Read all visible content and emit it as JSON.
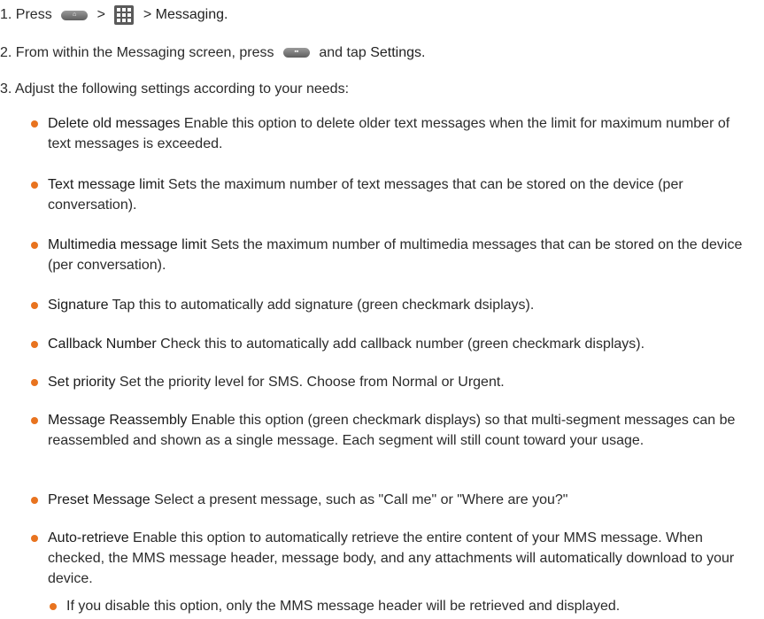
{
  "steps": [
    {
      "num": "1. Press",
      "sep1": ">",
      "sep2": ">",
      "target": "Messaging."
    },
    {
      "pre": "2. From within the Messaging screen, press",
      "mid": "and tap",
      "target": "Settings."
    },
    {
      "text": "3. Adjust the following settings according to your needs:"
    }
  ],
  "settings": [
    {
      "term": "Delete old messages",
      "desc": "Enable this option to delete older text messages when the limit for maximum number of text messages is exceeded."
    },
    {
      "term": "Text message limit",
      "desc": "Sets the maximum number of text messages that can be stored on the device (per conversation)."
    },
    {
      "term": "Multimedia message limit",
      "desc": "Sets the maximum number of multimedia messages that can be stored on the device (per conversation)."
    },
    {
      "term": "Signature",
      "desc": "Tap this to automatically add signature (green checkmark dsiplays)."
    },
    {
      "term": "Callback Number",
      "desc": "Check this to automatically add callback number (green checkmark displays)."
    },
    {
      "term": "Set priority",
      "desc": "Set the priority level for SMS. Choose from Normal or Urgent."
    },
    {
      "term": "Message Reassembly",
      "desc": "Enable this option (green checkmark displays) so that multi-segment messages can be reassembled and shown as a single message. Each segment will still count toward your usage."
    },
    {
      "term": "Preset Message",
      "desc": "Select a present message, such as \"Call me\" or \"Where are you?\""
    },
    {
      "term": "Auto-retrieve",
      "desc": "Enable this option to automatically retrieve the entire content of your MMS message. When checked, the MMS message header, message body, and any attachments will automatically download to your device."
    }
  ],
  "sub_bullet": "If you disable this option, only the MMS message header will be retrieved and displayed.",
  "icons": {
    "home_key": "home-key-icon",
    "apps_grid": "apps-grid-icon",
    "menu_key": "menu-key-icon",
    "bullet_color": "#e8731f"
  }
}
